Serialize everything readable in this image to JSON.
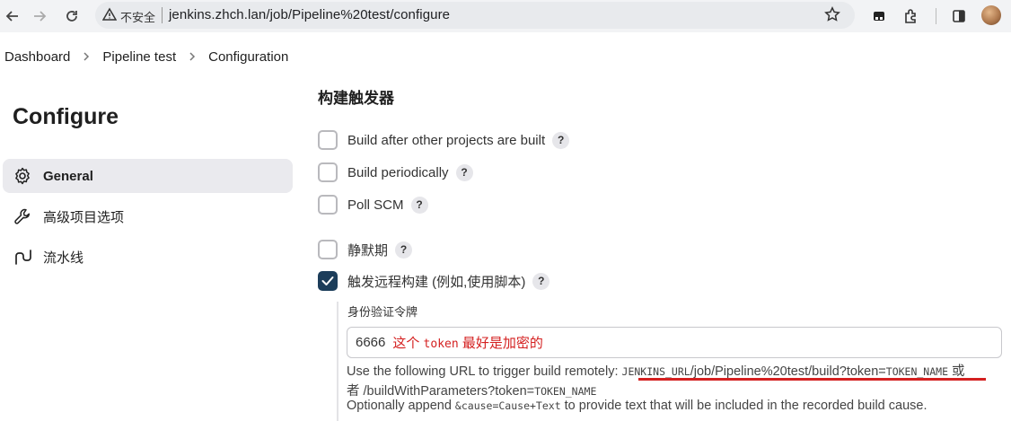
{
  "browser": {
    "insecure_label": "不安全",
    "url": "jenkins.zhch.lan/job/Pipeline%20test/configure"
  },
  "breadcrumb": [
    "Dashboard",
    "Pipeline test",
    "Configuration"
  ],
  "sidebar": {
    "title": "Configure",
    "items": [
      {
        "label": "General",
        "icon": "gear-icon",
        "active": true
      },
      {
        "label": "高级项目选项",
        "icon": "wrench-icon",
        "active": false
      },
      {
        "label": "流水线",
        "icon": "pipeline-icon",
        "active": false
      }
    ]
  },
  "main": {
    "section_heading": "构建触发器",
    "triggers": [
      {
        "label": "Build after other projects are built",
        "checked": false
      },
      {
        "label": "Build periodically",
        "checked": false
      },
      {
        "label": "Poll SCM",
        "checked": false
      },
      {
        "label": "静默期",
        "checked": false
      },
      {
        "label": "触发远程构建 (例如,使用脚本)",
        "checked": true
      }
    ],
    "help_label": "?",
    "token": {
      "label": "身份验证令牌",
      "value": "6666",
      "annotation_prefix": "这个 ",
      "annotation_code": "token",
      "annotation_suffix": " 最好是加密的"
    },
    "desc1_prefix": "Use the following URL to trigger build remotely: ",
    "desc1_code": "JENKINS_URL",
    "desc1_mid": "/job/Pipeline%20test/build?token=",
    "desc1_code2": "TOKEN_NAME",
    "desc1_suffix": " 或",
    "desc2_prefix": "者 /buildWithParameters?token=",
    "desc2_code": "TOKEN_NAME",
    "desc3_prefix": "Optionally append ",
    "desc3_code": "&cause=Cause+Text",
    "desc3_suffix": " to provide text that will be included in the recorded build cause."
  },
  "colors": {
    "checked": "#1c3d5a",
    "annotation": "#d42020",
    "active_item": "#eaeaee"
  }
}
